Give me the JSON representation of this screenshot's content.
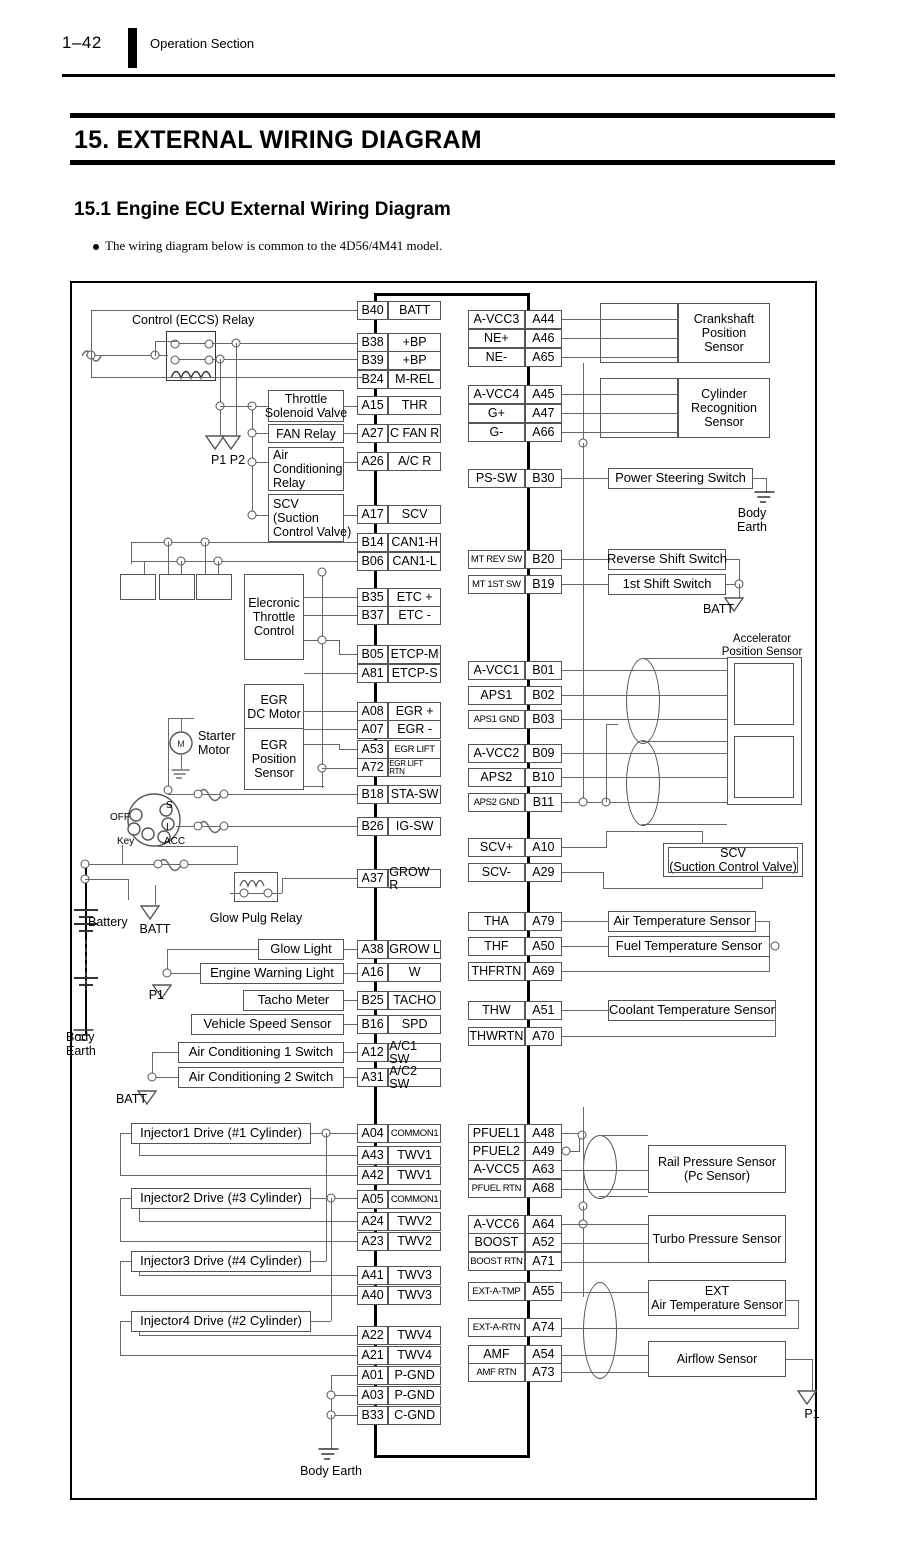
{
  "header": {
    "page_number": "1–42",
    "section": "Operation Section",
    "title": "15.  EXTERNAL WIRING DIAGRAM",
    "subtitle": "15.1  Engine ECU External Wiring Diagram",
    "note": "The wiring diagram below is common to the 4D56/4M41 model."
  },
  "left_terminals": [
    {
      "pin": "B40",
      "signal": "BATT"
    },
    {
      "pin": "B38",
      "signal": "+BP"
    },
    {
      "pin": "B39",
      "signal": "+BP"
    },
    {
      "pin": "B24",
      "signal": "M-REL"
    },
    {
      "pin": "A15",
      "signal": "THR"
    },
    {
      "pin": "A27",
      "signal": "C FAN R"
    },
    {
      "pin": "A26",
      "signal": "A/C R"
    },
    {
      "pin": "A17",
      "signal": "SCV"
    },
    {
      "pin": "B14",
      "signal": "CAN1-H"
    },
    {
      "pin": "B06",
      "signal": "CAN1-L"
    },
    {
      "pin": "B35",
      "signal": "ETC +"
    },
    {
      "pin": "B37",
      "signal": "ETC -"
    },
    {
      "pin": "B05",
      "signal": "ETCP-M"
    },
    {
      "pin": "A81",
      "signal": "ETCP-S"
    },
    {
      "pin": "A08",
      "signal": "EGR +"
    },
    {
      "pin": "A07",
      "signal": "EGR -"
    },
    {
      "pin": "A53",
      "signal": "EGR LIFT"
    },
    {
      "pin": "A72",
      "signal": "EGR LIFT RTN"
    },
    {
      "pin": "B18",
      "signal": "STA-SW"
    },
    {
      "pin": "B26",
      "signal": "IG-SW"
    },
    {
      "pin": "A37",
      "signal": "GROW R"
    },
    {
      "pin": "A38",
      "signal": "GROW L"
    },
    {
      "pin": "A16",
      "signal": "W"
    },
    {
      "pin": "B25",
      "signal": "TACHO"
    },
    {
      "pin": "B16",
      "signal": "SPD"
    },
    {
      "pin": "A12",
      "signal": "A/C1 SW"
    },
    {
      "pin": "A31",
      "signal": "A/C2 SW"
    },
    {
      "pin": "A04",
      "signal": "COMMON1"
    },
    {
      "pin": "A43",
      "signal": "TWV1"
    },
    {
      "pin": "A42",
      "signal": "TWV1"
    },
    {
      "pin": "A05",
      "signal": "COMMON1"
    },
    {
      "pin": "A24",
      "signal": "TWV2"
    },
    {
      "pin": "A23",
      "signal": "TWV2"
    },
    {
      "pin": "A41",
      "signal": "TWV3"
    },
    {
      "pin": "A40",
      "signal": "TWV3"
    },
    {
      "pin": "A22",
      "signal": "TWV4"
    },
    {
      "pin": "A21",
      "signal": "TWV4"
    },
    {
      "pin": "A01",
      "signal": "P-GND"
    },
    {
      "pin": "A03",
      "signal": "P-GND"
    },
    {
      "pin": "B33",
      "signal": "C-GND"
    }
  ],
  "right_terminals": [
    {
      "signal": "A-VCC3",
      "pin": "A44"
    },
    {
      "signal": "NE+",
      "pin": "A46"
    },
    {
      "signal": "NE-",
      "pin": "A65"
    },
    {
      "signal": "A-VCC4",
      "pin": "A45"
    },
    {
      "signal": "G+",
      "pin": "A47"
    },
    {
      "signal": "G-",
      "pin": "A66"
    },
    {
      "signal": "PS-SW",
      "pin": "B30"
    },
    {
      "signal": "MT REV SW",
      "pin": "B20"
    },
    {
      "signal": "MT 1ST SW",
      "pin": "B19"
    },
    {
      "signal": "A-VCC1",
      "pin": "B01"
    },
    {
      "signal": "APS1",
      "pin": "B02"
    },
    {
      "signal": "APS1 GND",
      "pin": "B03"
    },
    {
      "signal": "A-VCC2",
      "pin": "B09"
    },
    {
      "signal": "APS2",
      "pin": "B10"
    },
    {
      "signal": "APS2 GND",
      "pin": "B11"
    },
    {
      "signal": "SCV+",
      "pin": "A10"
    },
    {
      "signal": "SCV-",
      "pin": "A29"
    },
    {
      "signal": "THA",
      "pin": "A79"
    },
    {
      "signal": "THF",
      "pin": "A50"
    },
    {
      "signal": "THFRTN",
      "pin": "A69"
    },
    {
      "signal": "THW",
      "pin": "A51"
    },
    {
      "signal": "THWRTN",
      "pin": "A70"
    },
    {
      "signal": "PFUEL1",
      "pin": "A48"
    },
    {
      "signal": "PFUEL2",
      "pin": "A49"
    },
    {
      "signal": "A-VCC5",
      "pin": "A63"
    },
    {
      "signal": "PFUEL RTN",
      "pin": "A68"
    },
    {
      "signal": "A-VCC6",
      "pin": "A64"
    },
    {
      "signal": "BOOST",
      "pin": "A52"
    },
    {
      "signal": "BOOST RTN",
      "pin": "A71"
    },
    {
      "signal": "EXT-A-TMP",
      "pin": "A55"
    },
    {
      "signal": "EXT-A-RTN",
      "pin": "A74"
    },
    {
      "signal": "AMF",
      "pin": "A54"
    },
    {
      "signal": "AMF RTN",
      "pin": "A73"
    }
  ],
  "left_devices": {
    "control_relay": "Control (ECCS) Relay",
    "throttle_solenoid_valve": "Throttle\nSolenoid Valve",
    "fan_relay": "FAN Relay",
    "air_conditioning_relay": "Air\nConditioning\nRelay",
    "scv": "SCV\n(Suction\nControl Valve)",
    "electronic_throttle_control": "Elecronic\nThrottle\nControl",
    "egr_dc_motor": "EGR\nDC Motor",
    "egr_position_sensor": "EGR\nPosition\nSensor",
    "starter_motor": "Starter\nMotor",
    "glow_plug_relay": "Glow Pulg Relay",
    "glow_light": "Glow Light",
    "engine_warning_light": "Engine Warning Light",
    "tacho_meter": "Tacho Meter",
    "vehicle_speed_sensor": "Vehicle Speed Sensor",
    "air_conditioning_1_switch": "Air Conditioning 1 Switch",
    "air_conditioning_2_switch": "Air Conditioning 2 Switch",
    "injector1": "Injector1 Drive (#1 Cylinder)",
    "injector2": "Injector2 Drive (#3 Cylinder)",
    "injector3": "Injector3 Drive (#4 Cylinder)",
    "injector4": "Injector4 Drive (#2 Cylinder)",
    "battery": "Battery"
  },
  "right_devices": {
    "crankshaft_position_sensor": "Crankshaft\nPosition\nSensor",
    "cylinder_recognition_sensor": "Cylinder\nRecognition\nSensor",
    "power_steering_switch": "Power Steering Switch",
    "reverse_shift_switch": "Reverse Shift Switch",
    "first_shift_switch": "1st Shift Switch",
    "accelerator_position_sensor": "Accelerator\nPosition Sensor",
    "scv": "SCV\n(Suction Control Valve)",
    "air_temperature_sensor": "Air Temperature Sensor",
    "fuel_temperature_sensor": "Fuel Temperature Sensor",
    "coolant_temperature_sensor": "Coolant Temperature Sensor",
    "rail_pressure_sensor": "Rail Pressure Sensor\n(Pc Sensor)",
    "turbo_pressure_sensor": "Turbo Pressure Sensor",
    "ext_air_temperature_sensor": "EXT\nAir Temperature Sensor",
    "airflow_sensor": "Airflow Sensor"
  },
  "markers": {
    "p1": "P1",
    "p2": "P2",
    "p1p2": "P1 P2",
    "batt": "BATT",
    "body_earth": "Body\nEarth",
    "body_earth_inline": "Body Earth",
    "key": "Key",
    "key_off": "OFF",
    "key_acc": "ACC",
    "key_s": "S",
    "key_i": "I",
    "motor_m": "M"
  }
}
